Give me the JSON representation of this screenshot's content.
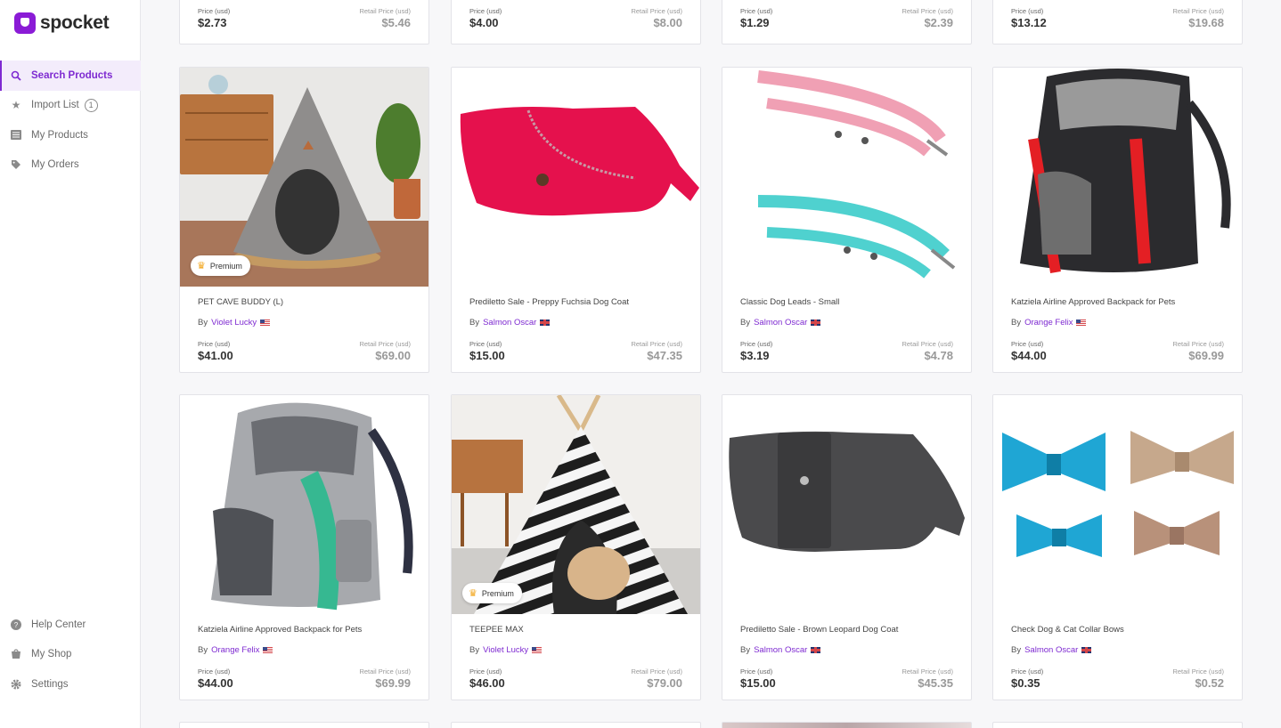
{
  "brand": {
    "name": "spocket",
    "color": "#7e2ad1"
  },
  "nav_top": [
    {
      "label": "Search Products",
      "icon": "search-icon",
      "active": true
    },
    {
      "label": "Import List",
      "icon": "star-icon",
      "badge": "1"
    },
    {
      "label": "My Products",
      "icon": "list-icon"
    },
    {
      "label": "My Orders",
      "icon": "tag-icon"
    }
  ],
  "nav_bottom": [
    {
      "label": "Help Center",
      "icon": "help-icon"
    },
    {
      "label": "My Shop",
      "icon": "shop-icon"
    },
    {
      "label": "Settings",
      "icon": "gear-icon"
    }
  ],
  "labels": {
    "price": "Price (usd)",
    "retail": "Retail Price (usd)",
    "by": "By",
    "premium": "Premium"
  },
  "top_row": [
    {
      "price": "$2.73",
      "retail": "$5.46"
    },
    {
      "price": "$4.00",
      "retail": "$8.00"
    },
    {
      "price": "$1.29",
      "retail": "$2.39"
    },
    {
      "price": "$13.12",
      "retail": "$19.68"
    }
  ],
  "products": [
    {
      "title": "PET CAVE BUDDY (L)",
      "seller": "Violet Lucky",
      "flag": "us",
      "price": "$41.00",
      "retail": "$69.00",
      "premium": true,
      "image": "felt-cave"
    },
    {
      "title": "Prediletto Sale - Preppy Fuchsia Dog Coat",
      "seller": "Salmon Oscar",
      "flag": "uk",
      "price": "$15.00",
      "retail": "$47.35",
      "premium": false,
      "image": "fuchsia-coat"
    },
    {
      "title": "Classic Dog Leads - Small",
      "seller": "Salmon Oscar",
      "flag": "uk",
      "price": "$3.19",
      "retail": "$4.78",
      "premium": false,
      "image": "dog-leads"
    },
    {
      "title": "Katziela Airline Approved Backpack for Pets",
      "seller": "Orange Felix",
      "flag": "us",
      "price": "$44.00",
      "retail": "$69.99",
      "premium": false,
      "image": "red-backpack"
    },
    {
      "title": "Katziela Airline Approved Backpack for Pets",
      "seller": "Orange Felix",
      "flag": "us",
      "price": "$44.00",
      "retail": "$69.99",
      "premium": false,
      "image": "grey-backpack"
    },
    {
      "title": "TEEPEE MAX",
      "seller": "Violet Lucky",
      "flag": "us",
      "price": "$46.00",
      "retail": "$79.00",
      "premium": true,
      "image": "teepee"
    },
    {
      "title": "Prediletto Sale - Brown Leopard Dog Coat",
      "seller": "Salmon Oscar",
      "flag": "uk",
      "price": "$15.00",
      "retail": "$45.35",
      "premium": false,
      "image": "leopard-coat"
    },
    {
      "title": "Check Dog & Cat Collar Bows",
      "seller": "Salmon Oscar",
      "flag": "uk",
      "price": "$0.35",
      "retail": "$0.52",
      "premium": false,
      "image": "bows"
    }
  ]
}
